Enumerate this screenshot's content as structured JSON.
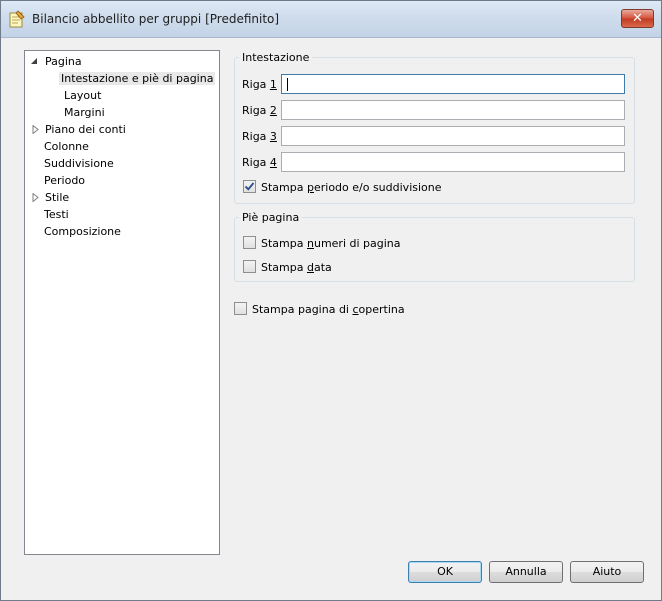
{
  "window": {
    "title": "Bilancio abbellito per gruppi [Predefinito]"
  },
  "tree": {
    "items": [
      {
        "label": "Pagina",
        "expander": "expanded"
      },
      {
        "label": "Intestazione e piè di pagina",
        "selected": true
      },
      {
        "label": "Layout"
      },
      {
        "label": "Margini"
      },
      {
        "label": "Piano dei conti",
        "expander": "collapsed"
      },
      {
        "label": "Colonne"
      },
      {
        "label": "Suddivisione"
      },
      {
        "label": "Periodo"
      },
      {
        "label": "Stile",
        "expander": "collapsed"
      },
      {
        "label": "Testi"
      },
      {
        "label": "Composizione"
      }
    ]
  },
  "header_group": {
    "title": "Intestazione",
    "rows": [
      {
        "prefix": "Riga ",
        "key": "1",
        "value": ""
      },
      {
        "prefix": "Riga ",
        "key": "2",
        "value": ""
      },
      {
        "prefix": "Riga ",
        "key": "3",
        "value": ""
      },
      {
        "prefix": "Riga ",
        "key": "4",
        "value": ""
      }
    ],
    "print_period": {
      "pre": "Stampa ",
      "key": "p",
      "post": "eriodo e/o suddivisione",
      "checked": true
    }
  },
  "footer_group": {
    "title": "Piè pagina",
    "page_numbers": {
      "pre": "Stampa ",
      "key": "n",
      "post": "umeri di pagina",
      "checked": false
    },
    "print_date": {
      "pre": "Stampa ",
      "key": "d",
      "post": "ata",
      "checked": false
    }
  },
  "cover_page": {
    "pre": "Stampa pagina di ",
    "key": "c",
    "post": "opertina",
    "checked": false
  },
  "buttons": {
    "ok": "OK",
    "cancel": "Annulla",
    "help": "Aiuto"
  },
  "colors": {
    "titlebar": "#c3d3e7",
    "close": "#c23b24",
    "accent": "#3c7fb1"
  }
}
